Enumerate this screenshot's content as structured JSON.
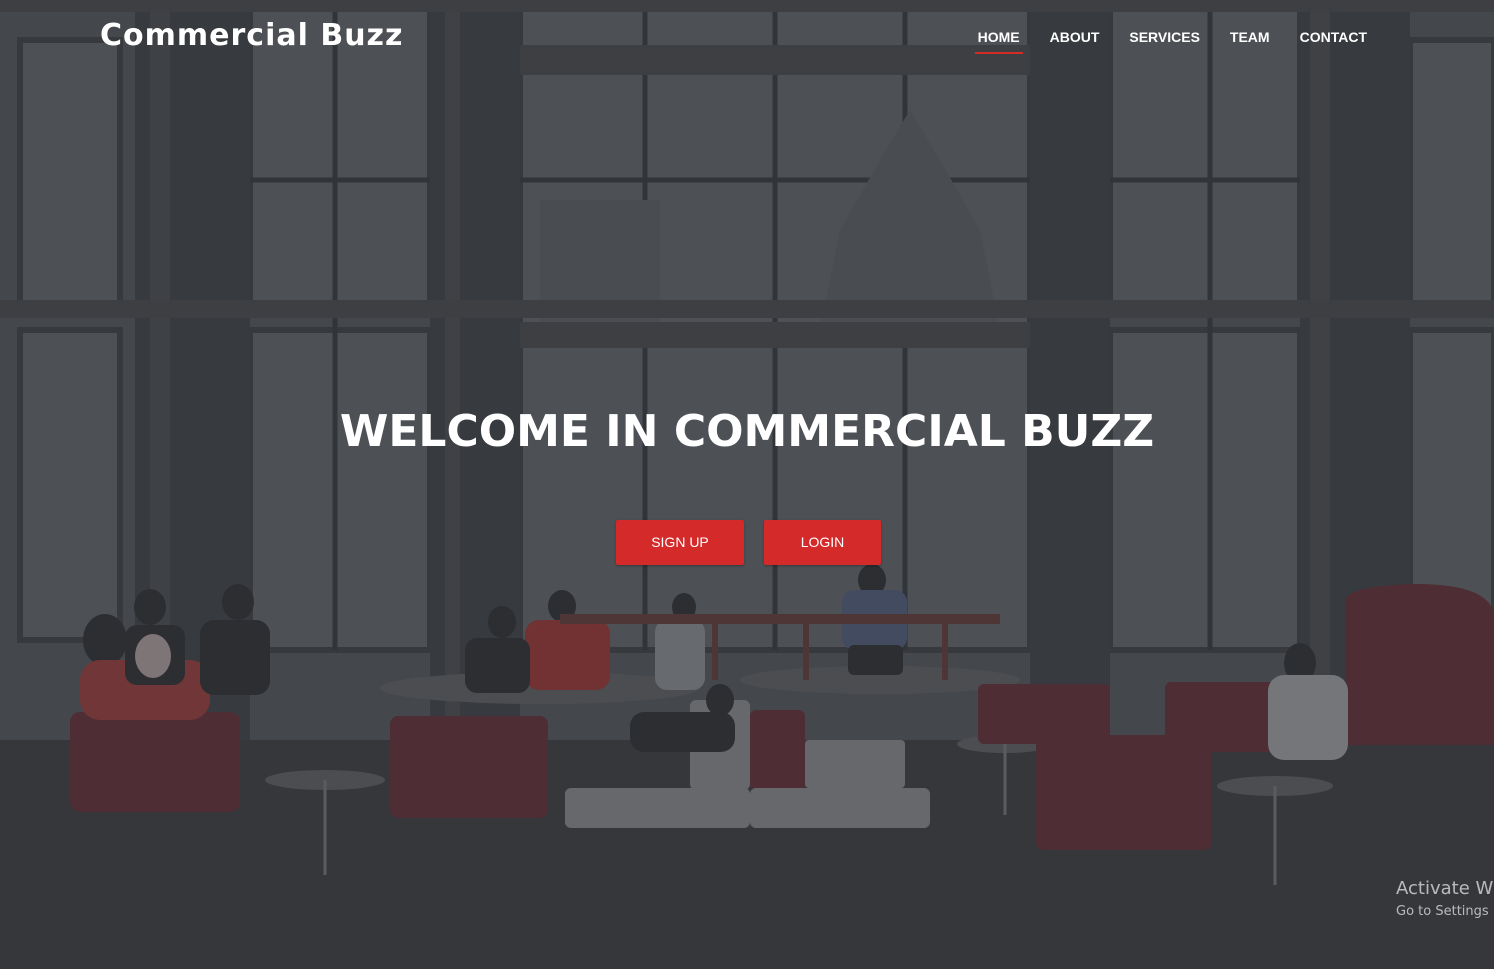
{
  "brand": {
    "name": "Commercial Buzz"
  },
  "nav": {
    "items": [
      {
        "label": "HOME",
        "active": true
      },
      {
        "label": "ABOUT",
        "active": false
      },
      {
        "label": "SERVICES",
        "active": false
      },
      {
        "label": "TEAM",
        "active": false
      },
      {
        "label": "CONTACT",
        "active": false
      }
    ]
  },
  "hero": {
    "headline": "WELCOME IN COMMERCIAL BUZZ",
    "signup_label": "SIGN UP",
    "login_label": "LOGIN"
  },
  "watermark": {
    "title": "Activate Wi",
    "subtitle": "Go to Settings"
  },
  "colors": {
    "accent": "#d42a2a",
    "text": "#ffffff",
    "overlay": "#3b3d42"
  }
}
